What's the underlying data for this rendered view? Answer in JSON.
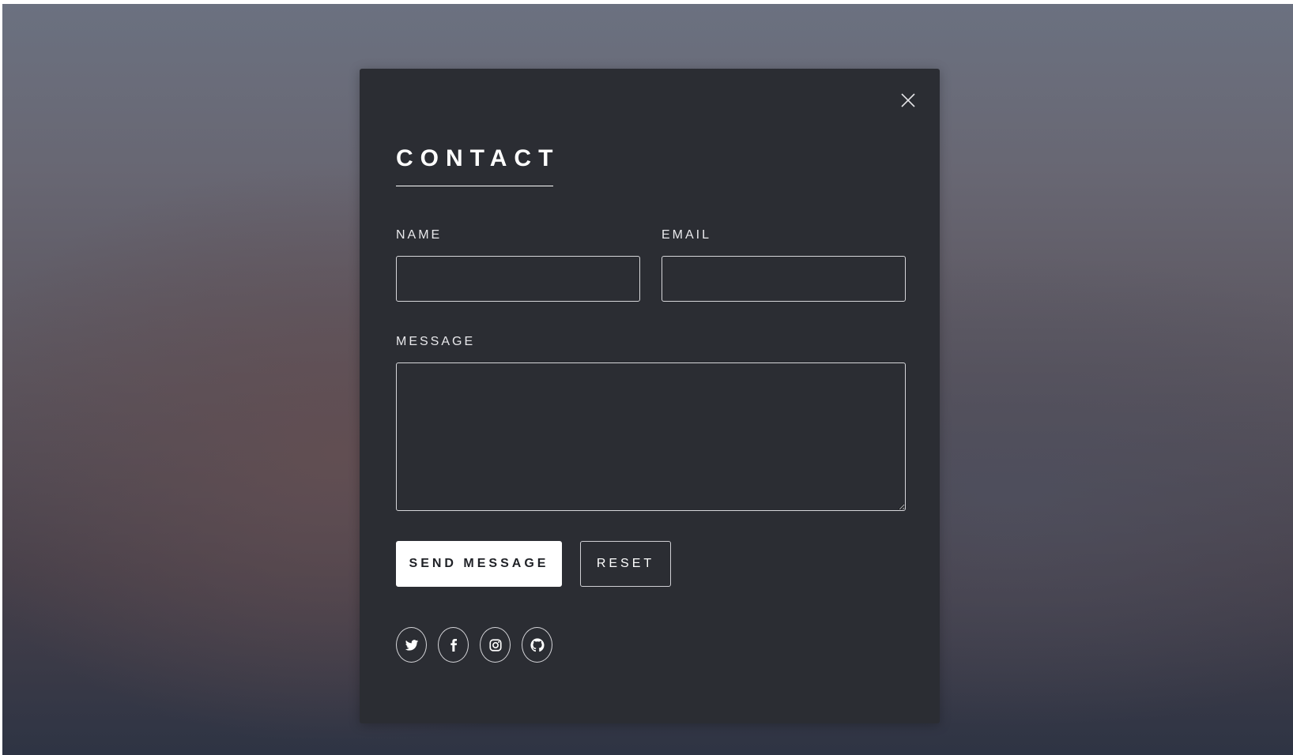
{
  "contact_form": {
    "title": "CONTACT",
    "name_label": "NAME",
    "name_value": "",
    "email_label": "EMAIL",
    "email_value": "",
    "message_label": "MESSAGE",
    "message_value": "",
    "send_label": "SEND MESSAGE",
    "reset_label": "RESET"
  },
  "socials": [
    "twitter-icon",
    "facebook-icon",
    "instagram-icon",
    "github-icon"
  ],
  "colors": {
    "modal_bg": "#2b2d33",
    "accent": "#ffffff"
  }
}
